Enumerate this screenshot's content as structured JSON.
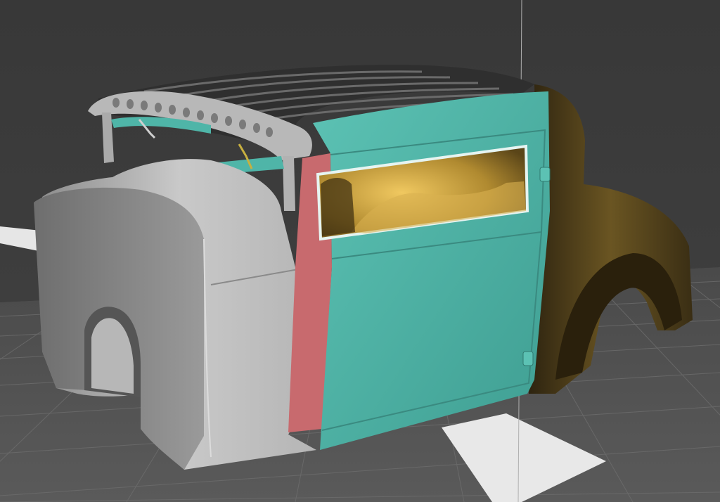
{
  "viewport": {
    "background_color": "#3b3b3b",
    "floor_color": "#555555",
    "grid_line_color": "#7a7a7a",
    "highlight_floor_color": "#e8e8e8",
    "guide_line_color": "#b8b8b8"
  },
  "model": {
    "panels": [
      {
        "name": "front-cowl",
        "color": "#bdbdbd"
      },
      {
        "name": "a-pillar-strip",
        "color": "#c86a6e"
      },
      {
        "name": "door-panel",
        "color": "#4fb5a8"
      },
      {
        "name": "rear-quarter",
        "color": "#4a3c18"
      },
      {
        "name": "roof-slats",
        "color": "#3c3c3c"
      },
      {
        "name": "interior",
        "color": "#c8a040"
      }
    ]
  }
}
